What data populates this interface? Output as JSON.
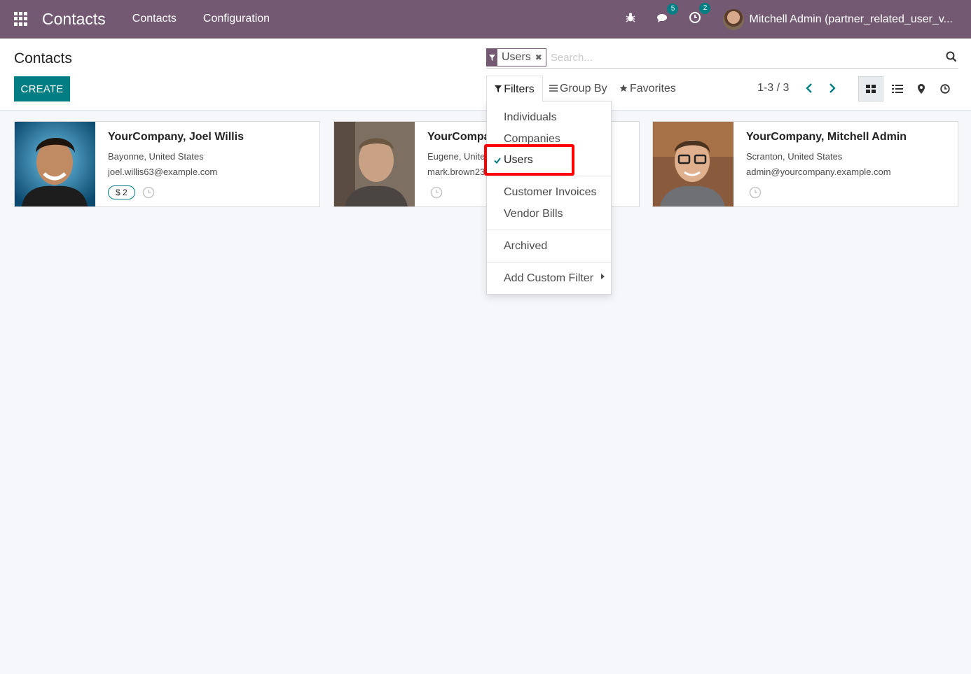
{
  "navbar": {
    "app_name": "Contacts",
    "menus": [
      "Contacts",
      "Configuration"
    ],
    "messages_count": "5",
    "activities_count": "2",
    "user_name": "Mitchell Admin (partner_related_user_v..."
  },
  "control_panel": {
    "title": "Contacts",
    "create_label": "CREATE",
    "facet": {
      "value": "Users",
      "remove": "✖"
    },
    "search_placeholder": "Search...",
    "filters_label": "Filters",
    "groupby_label": "Group By",
    "favorites_label": "Favorites",
    "pager": "1-3 / 3"
  },
  "filters_menu": {
    "items": [
      "Individuals",
      "Companies",
      "Users",
      "Customer Invoices",
      "Vendor Bills",
      "Archived",
      "Add Custom Filter"
    ],
    "selected": "Users"
  },
  "cards": [
    {
      "name": "YourCompany, Joel Willis",
      "location": "Bayonne, United States",
      "email": "joel.willis63@example.com",
      "badge": "$ 2"
    },
    {
      "name": "YourCompany, Mark Brown",
      "location": "Eugene, United States",
      "email": "mark.brown23@example.com"
    },
    {
      "name": "YourCompany, Mitchell Admin",
      "location": "Scranton, United States",
      "email": "admin@yourcompany.example.com"
    }
  ],
  "colors": {
    "brand": "#735a72",
    "accent": "#017e84",
    "highlight": "#ff0000"
  }
}
